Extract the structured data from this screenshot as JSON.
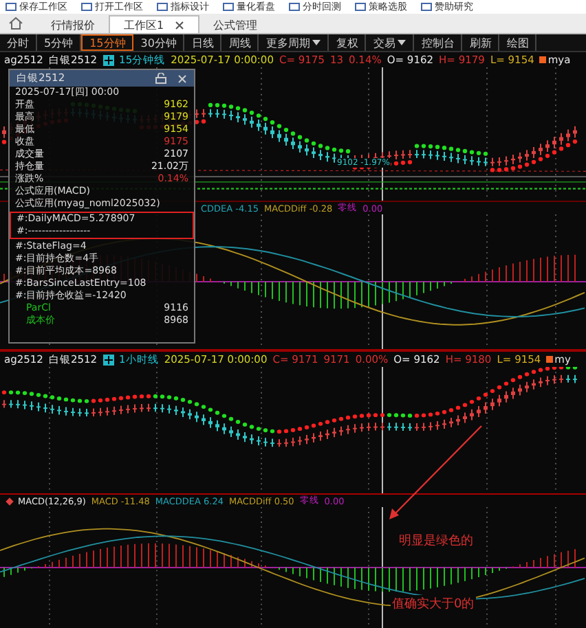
{
  "toolbar": [
    "保存工作区",
    "打开工作区",
    "指标设计",
    "量化看盘",
    "分时回测",
    "策略选股",
    "赞助研究"
  ],
  "tabs": [
    {
      "label": "行情报价",
      "selected": false,
      "closable": false
    },
    {
      "label": "工作区1",
      "selected": true,
      "closable": true
    },
    {
      "label": "公式管理",
      "selected": false,
      "closable": false
    }
  ],
  "periods": [
    {
      "label": "分时",
      "selected": false,
      "dropdown": false
    },
    {
      "label": "5分钟",
      "selected": false,
      "dropdown": false
    },
    {
      "label": "15分钟",
      "selected": true,
      "dropdown": false
    },
    {
      "label": "30分钟",
      "selected": false,
      "dropdown": false
    },
    {
      "label": "日线",
      "selected": false,
      "dropdown": false
    },
    {
      "label": "周线",
      "selected": false,
      "dropdown": false
    },
    {
      "label": "更多周期",
      "selected": false,
      "dropdown": true
    },
    {
      "label": "复权",
      "selected": false,
      "dropdown": false
    },
    {
      "label": "交易",
      "selected": false,
      "dropdown": true
    },
    {
      "label": "控制台",
      "selected": false,
      "dropdown": false
    },
    {
      "label": "刷新",
      "selected": false,
      "dropdown": false
    },
    {
      "label": "绘图",
      "selected": false,
      "dropdown": false
    }
  ],
  "charts": [
    {
      "header": [
        {
          "text": "ag2512",
          "color": "#e8e8e8"
        },
        {
          "text": "白银2512",
          "color": "#e8e8e8"
        },
        {
          "text": "15分钟线",
          "color": "#22c8d8"
        },
        {
          "text": "2025-07-17 0:00:00",
          "color": "#d8d820"
        },
        {
          "text": "C= 9175",
          "color": "#e03030"
        },
        {
          "text": "13",
          "color": "#e03030"
        },
        {
          "text": "0.14%",
          "color": "#e03030"
        },
        {
          "text": "O= 9162",
          "color": "#e8e8e8"
        },
        {
          "text": "H= 9179",
          "color": "#e03030"
        },
        {
          "text": "L= 9154",
          "color": "#d8b020"
        },
        {
          "text": "mya",
          "color": "#e8e8e8"
        }
      ],
      "price_label": "9102 -1.97%",
      "legend": [
        {
          "text": "CDDEA -4.15",
          "color": "#22a8b8"
        },
        {
          "text": "MACDDiff -0.28",
          "color": "#c0a020"
        },
        {
          "text": "零线",
          "color": "#c020c0"
        },
        {
          "text": "0.00",
          "color": "#c020c0"
        }
      ]
    },
    {
      "header": [
        {
          "text": "ag2512",
          "color": "#e8e8e8"
        },
        {
          "text": "白银2512",
          "color": "#e8e8e8"
        },
        {
          "text": "1小时线",
          "color": "#22c8d8"
        },
        {
          "text": "2025-07-17 0:00:00",
          "color": "#d8d820"
        },
        {
          "text": "C= 9171",
          "color": "#e03030"
        },
        {
          "text": "9171",
          "color": "#e03030"
        },
        {
          "text": "0.00%",
          "color": "#e03030"
        },
        {
          "text": "O= 9162",
          "color": "#e8e8e8"
        },
        {
          "text": "H= 9180",
          "color": "#e03030"
        },
        {
          "text": "L= 9154",
          "color": "#d8b020"
        },
        {
          "text": "my",
          "color": "#e8e8e8"
        }
      ],
      "legend": [
        {
          "text": "MACD(12,26,9)",
          "color": "#e8e8e8"
        },
        {
          "text": "MACD -11.48",
          "color": "#c0a020"
        },
        {
          "text": "MACDDEA 6.24",
          "color": "#22a8b8"
        },
        {
          "text": "MACDDiff 0.50",
          "color": "#c0a020"
        },
        {
          "text": "零线",
          "color": "#c020c0"
        },
        {
          "text": "0.00",
          "color": "#c020c0"
        }
      ]
    }
  ],
  "panel": {
    "title": "白银2512",
    "date": "2025-07-17[四] 00:00",
    "rows": [
      {
        "label": "开盘",
        "value": "9162",
        "color": "#e0e020"
      },
      {
        "label": "最高",
        "value": "9179",
        "color": "#e0e020"
      },
      {
        "label": "最低",
        "value": "9154",
        "color": "#e0e020"
      },
      {
        "label": "收盘",
        "value": "9175",
        "color": "#e03030"
      },
      {
        "label": "成交量",
        "value": "2107",
        "color": "#e8e8e8"
      },
      {
        "label": "持仓量",
        "value": "21.02万",
        "color": "#e8e8e8"
      },
      {
        "label": "涨跌%",
        "value": "0.14%",
        "color": "#e03030"
      }
    ],
    "formulas": [
      "公式应用(MACD)",
      "公式应用(myag_noml2025032)"
    ],
    "highlighted": [
      "#:DailyMACD=5.278907",
      "#:------------------"
    ],
    "lines": [
      "#:StateFlag=4",
      "#:目前持仓数=4手",
      "#:目前平均成本=8968",
      "#:BarsSinceLastEntry=108",
      "#:目前持仓收益=-12420"
    ],
    "params": [
      {
        "label": "ParCl",
        "value": "9116"
      },
      {
        "label": "成本价",
        "value": "8968"
      }
    ]
  },
  "annotations": [
    "明显是绿色的",
    "值确实大于0的"
  ]
}
